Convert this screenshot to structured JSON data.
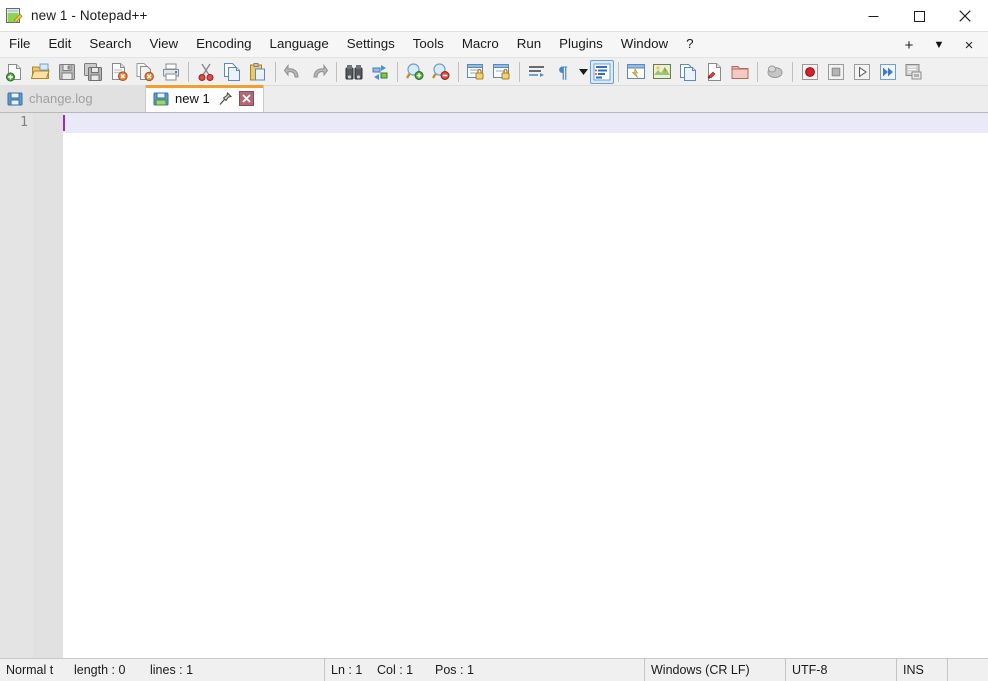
{
  "window": {
    "title": "new 1 - Notepad++",
    "icon": "notepad-plus-plus-icon",
    "controls": {
      "minimize": "minimize-icon",
      "maximize": "maximize-icon",
      "close": "close-icon"
    }
  },
  "menubar": {
    "items": [
      {
        "label": "File"
      },
      {
        "label": "Edit"
      },
      {
        "label": "Search"
      },
      {
        "label": "View"
      },
      {
        "label": "Encoding"
      },
      {
        "label": "Language"
      },
      {
        "label": "Settings"
      },
      {
        "label": "Tools"
      },
      {
        "label": "Macro"
      },
      {
        "label": "Run"
      },
      {
        "label": "Plugins"
      },
      {
        "label": "Window"
      },
      {
        "label": "?"
      }
    ],
    "right": {
      "add": "+",
      "dropdown": "▼",
      "close": "×"
    }
  },
  "toolbar": {
    "buttons": [
      {
        "name": "new-file-button",
        "title": "New"
      },
      {
        "name": "open-file-button",
        "title": "Open"
      },
      {
        "name": "save-button",
        "title": "Save"
      },
      {
        "name": "save-all-button",
        "title": "Save All"
      },
      {
        "name": "close-file-button",
        "title": "Close"
      },
      {
        "name": "close-all-files-button",
        "title": "Close All"
      },
      {
        "name": "print-button",
        "title": "Print"
      },
      {
        "name": "cut-button",
        "title": "Cut"
      },
      {
        "name": "copy-button",
        "title": "Copy"
      },
      {
        "name": "paste-button",
        "title": "Paste"
      },
      {
        "name": "undo-button",
        "title": "Undo"
      },
      {
        "name": "redo-button",
        "title": "Redo"
      },
      {
        "name": "find-button",
        "title": "Find"
      },
      {
        "name": "replace-button",
        "title": "Replace"
      },
      {
        "name": "zoom-in-button",
        "title": "Zoom In"
      },
      {
        "name": "zoom-out-button",
        "title": "Zoom Out"
      },
      {
        "name": "sync-vertical-scrolling-button",
        "title": "Synchronize Vertical Scrolling"
      },
      {
        "name": "sync-horizontal-scrolling-button",
        "title": "Synchronize Horizontal Scrolling"
      },
      {
        "name": "word-wrap-button",
        "title": "Word wrap"
      },
      {
        "name": "show-all-characters-button",
        "title": "Show All Characters",
        "active": true
      },
      {
        "name": "indent-guide-button",
        "title": "Show Indent Guide"
      },
      {
        "name": "user-defined-dialog-button",
        "title": "User-Defined Dialogue"
      },
      {
        "name": "document-map-button",
        "title": "Document Map"
      },
      {
        "name": "function-list-button",
        "title": "Function List"
      },
      {
        "name": "document-switcher-button",
        "title": "Document List"
      },
      {
        "name": "folder-as-workspace-button",
        "title": "Folder as Workspace"
      },
      {
        "name": "macro-recording-button",
        "title": "Start Recording"
      },
      {
        "name": "macro-record-button",
        "title": "Record"
      },
      {
        "name": "macro-stop-button",
        "title": "Stop Recording"
      },
      {
        "name": "macro-playback-button",
        "title": "Playback"
      },
      {
        "name": "macro-run-multiple-button",
        "title": "Run a Macro Multiple Times"
      },
      {
        "name": "run-button",
        "title": "Run"
      }
    ]
  },
  "tabs": [
    {
      "label": "change.log",
      "active": false,
      "icon": "saved-file-icon"
    },
    {
      "label": "new 1",
      "active": true,
      "icon": "unsaved-file-icon",
      "pin": "pin-icon",
      "close": "×"
    }
  ],
  "editor": {
    "lines": [
      "1"
    ],
    "content": "",
    "caret_line": 1,
    "caret_col": 1
  },
  "statusbar": {
    "doc_type": "Normal t",
    "length_label": "length : 0",
    "lines_label": "lines : 1",
    "ln": "Ln : 1",
    "col": "Col : 1",
    "pos": "Pos : 1",
    "eol": "Windows (CR LF)",
    "encoding": "UTF-8",
    "insert_mode": "INS"
  },
  "colors": {
    "tab_active_accent": "#f0a030",
    "current_line": "#e9e9f8",
    "caret": "#9b28c8",
    "gutter": "#e4e4e4",
    "toolbar_bg": "#f0f0f0"
  }
}
